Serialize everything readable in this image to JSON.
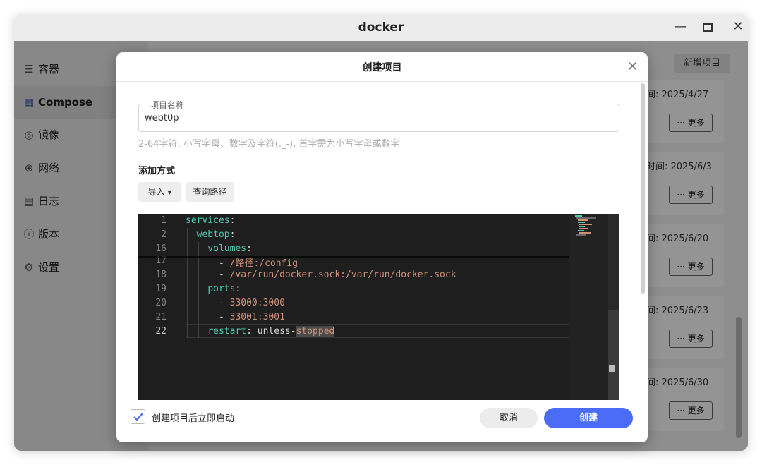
{
  "window": {
    "title": "docker",
    "minimize_icon": "minimize-icon",
    "maximize_icon": "maximize-icon",
    "close_icon": "close-icon"
  },
  "sidebar": {
    "items": [
      {
        "label": "容器",
        "icon": "layers-icon",
        "active": false
      },
      {
        "label": "Compose",
        "icon": "cubes-icon",
        "active": true
      },
      {
        "label": "镜像",
        "icon": "disc-icon",
        "active": false
      },
      {
        "label": "网络",
        "icon": "globe-icon",
        "active": false
      },
      {
        "label": "日志",
        "icon": "document-icon",
        "active": false
      },
      {
        "label": "版本",
        "icon": "info-icon",
        "active": false
      },
      {
        "label": "设置",
        "icon": "gear-icon",
        "active": false
      }
    ]
  },
  "toolbar": {
    "add_project_label": "新增项目"
  },
  "cards": [
    {
      "time_text": "间: 2025/4/27",
      "more_label": "··· 更多"
    },
    {
      "time_text": "时间: 2025/6/3",
      "more_label": "··· 更多"
    },
    {
      "time_text": "间: 2025/6/20",
      "more_label": "··· 更多"
    },
    {
      "time_text": "间: 2025/6/23",
      "more_label": "··· 更多"
    },
    {
      "time_text": "间: 2025/6/30",
      "more_label": "··· 更多"
    }
  ],
  "dialog": {
    "title": "创建项目",
    "name_field": {
      "legend": "项目名称",
      "value": "webt0p"
    },
    "hint": "2-64字符, 小写字母、数字及字符(._-), 首字需为小写字母或数字",
    "add_method_label": "添加方式",
    "import_label": "导入 ▾",
    "query_path_label": "查询路径",
    "editor": {
      "line_numbers": [
        "1",
        "2",
        "16",
        "17",
        "18",
        "19",
        "20",
        "21",
        "22"
      ],
      "lines": {
        "l1_key": "services",
        "l2_key": "webtop",
        "l16_key": "volumes",
        "l17_val": "/路径:/config",
        "l18_val": "/var/run/docker.sock:/var/run/docker.sock",
        "l19_key": "ports",
        "l20_val": "33000:3000",
        "l21_val": "33001:3001",
        "l22_key": "restart",
        "l22_val_plain": "unless-",
        "l22_val_selected": "stopped"
      }
    },
    "autostart_label": "创建项目后立即启动",
    "autostart_checked": true,
    "cancel_label": "取消",
    "create_label": "创建"
  },
  "colors": {
    "accent": "#4a6cf7",
    "yaml_key": "#4ec9b0",
    "yaml_string": "#ce9178",
    "editor_bg": "#1e1e1e"
  }
}
